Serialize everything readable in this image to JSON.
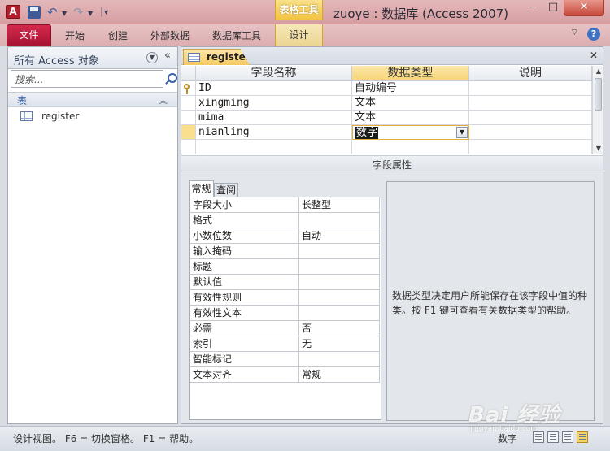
{
  "window": {
    "title": "zuoye : 数据库 (Access 2007)",
    "app_icon_letter": "A",
    "context_tab_header": "表格工具",
    "controls": {
      "minimize": "–",
      "maximize": "□",
      "close": "✕"
    }
  },
  "quick_access": {
    "save": "save-icon",
    "undo": "↶",
    "redo": "↷",
    "customize": "▾"
  },
  "ribbon": {
    "file_tab": "文件",
    "tabs": [
      "开始",
      "创建",
      "外部数据",
      "数据库工具"
    ],
    "context_tab": "设计",
    "help": "?"
  },
  "nav_pane": {
    "title": "所有 Access 对象",
    "search_placeholder": "搜索...",
    "group": "表",
    "items": [
      {
        "label": "register",
        "icon": "table-icon"
      }
    ]
  },
  "document": {
    "tab_label": "register",
    "columns": {
      "field_name": "字段名称",
      "data_type": "数据类型",
      "description": "说明"
    },
    "fields": [
      {
        "name": "ID",
        "type": "自动编号",
        "description": "",
        "primary_key": true
      },
      {
        "name": "xingming",
        "type": "文本",
        "description": ""
      },
      {
        "name": "mima",
        "type": "文本",
        "description": ""
      },
      {
        "name": "nianling",
        "type": "数字",
        "description": "",
        "current": true
      }
    ],
    "properties_title": "字段属性",
    "property_tabs": [
      "常规",
      "查阅"
    ],
    "properties": [
      {
        "label": "字段大小",
        "value": "长整型"
      },
      {
        "label": "格式",
        "value": ""
      },
      {
        "label": "小数位数",
        "value": "自动"
      },
      {
        "label": "输入掩码",
        "value": ""
      },
      {
        "label": "标题",
        "value": ""
      },
      {
        "label": "默认值",
        "value": ""
      },
      {
        "label": "有效性规则",
        "value": ""
      },
      {
        "label": "有效性文本",
        "value": ""
      },
      {
        "label": "必需",
        "value": "否"
      },
      {
        "label": "索引",
        "value": "无"
      },
      {
        "label": "智能标记",
        "value": ""
      },
      {
        "label": "文本对齐",
        "value": "常规"
      }
    ],
    "help_text": "数据类型决定用户所能保存在该字段中值的种类。按 F1 键可查看有关数据类型的帮助。"
  },
  "status_bar": {
    "text": "设计视图。 F6 = 切换窗格。 F1 = 帮助。",
    "mode": "数字"
  },
  "watermark": {
    "brand": "Bai 经验",
    "url": "jingyan.baidu.com"
  },
  "colors": {
    "title_bar": "#d79ea2",
    "file_tab": "#c01e40",
    "context_accent": "#f2c440",
    "selection": "#f9df8e"
  }
}
